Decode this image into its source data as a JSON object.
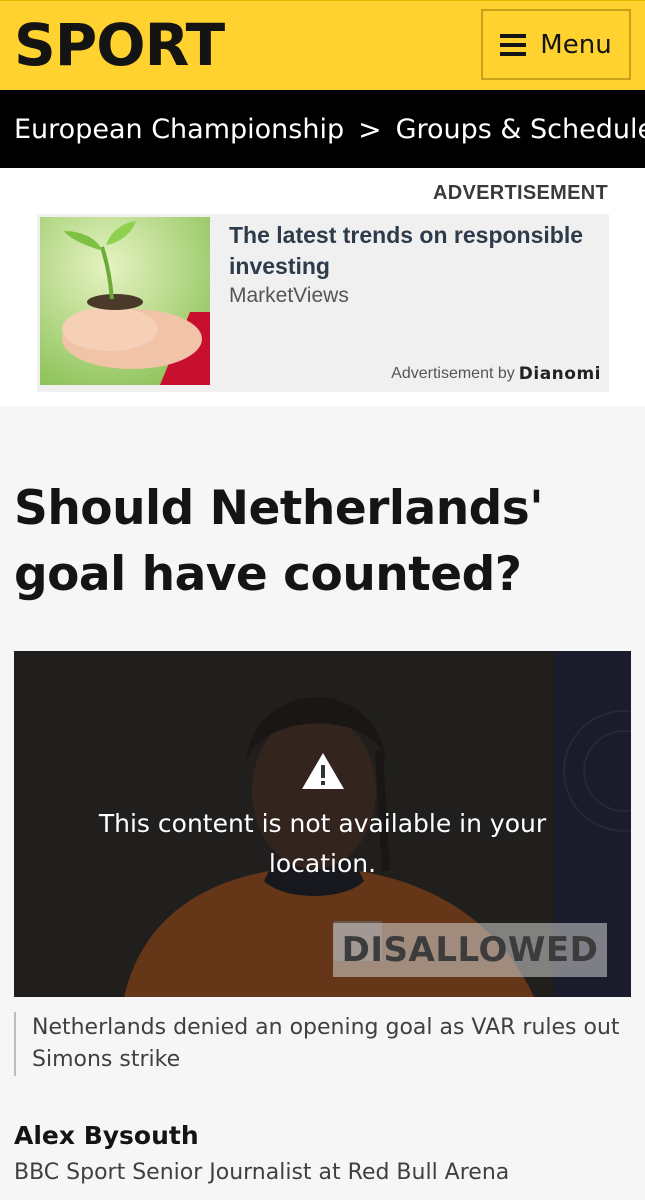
{
  "header": {
    "logo": "SPORT",
    "menu_label": "Menu"
  },
  "breadcrumb": {
    "items": [
      "European Championship",
      "Groups & Schedule"
    ],
    "separator": ">"
  },
  "advertisement": {
    "label": "ADVERTISEMENT",
    "title": "The latest trends on responsible investing",
    "source": "MarketViews",
    "by_label": "Advertisement by",
    "by_brand": "Dianomi"
  },
  "article": {
    "headline": "Should Netherlands' goal have counted?",
    "media": {
      "unavailable_message": "This content is not available in your location.",
      "overlay_badge": "DISALLOWED"
    },
    "caption": "Netherlands denied an opening goal as VAR rules out Simons strike",
    "author_name": "Alex Bysouth",
    "author_role": "BBC Sport Senior Journalist at Red Bull Arena"
  },
  "colors": {
    "header_bg": "#ffd230",
    "nav_bg": "#000000",
    "page_bg": "#f6f6f6"
  }
}
